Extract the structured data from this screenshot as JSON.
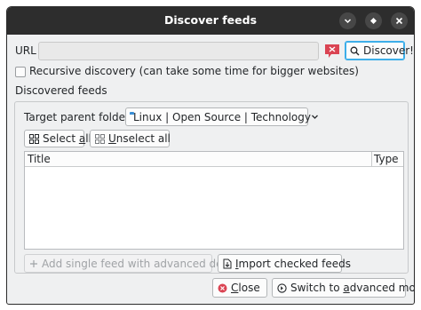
{
  "window": {
    "title": "Discover feeds",
    "controls": {
      "minimize": "▾",
      "maximize": "◆",
      "close": "✕"
    }
  },
  "url": {
    "label": "URL",
    "value": "",
    "discover_label": "Discover!"
  },
  "recursive": {
    "label": "Recursive discovery (can take some time for bigger websites)",
    "checked": false
  },
  "discovered": {
    "section_label": "Discovered feeds",
    "target_folder_label": "Target parent folder",
    "target_folder_value": "Linux | Open Source | Technology",
    "select_all_prefix": "Select ",
    "select_all_mnemonic": "a",
    "select_all_suffix": "ll",
    "unselect_all_mnemonic": "U",
    "unselect_all_suffix": "nselect all",
    "columns": [
      "Title",
      "Type"
    ],
    "rows": [],
    "add_single_label": "Add single feed with advanced details",
    "import_mnemonic": "I",
    "import_suffix": "mport checked feeds"
  },
  "footer": {
    "close_mnemonic": "C",
    "close_suffix": "lose",
    "advanced_prefix": "Switch to ",
    "advanced_mnemonic": "a",
    "advanced_suffix": "dvanced mode"
  },
  "colors": {
    "titlebar": "#2d2d2d",
    "window_bg": "#eff0f1",
    "accent": "#3daee9",
    "folder_icon": "#3b8fd6",
    "error_icon": "#da4453",
    "close_icon": "#da4453"
  },
  "icons": {
    "url_status": "error-flag-icon",
    "discover": "search-icon",
    "select_all": "select-all-icon",
    "unselect_all": "unselect-all-icon",
    "folder": "folder-icon",
    "dropdown": "chevron-down-icon",
    "add_single": "plus-icon",
    "import": "import-icon",
    "close": "close-circle-icon",
    "advanced": "switch-icon"
  }
}
